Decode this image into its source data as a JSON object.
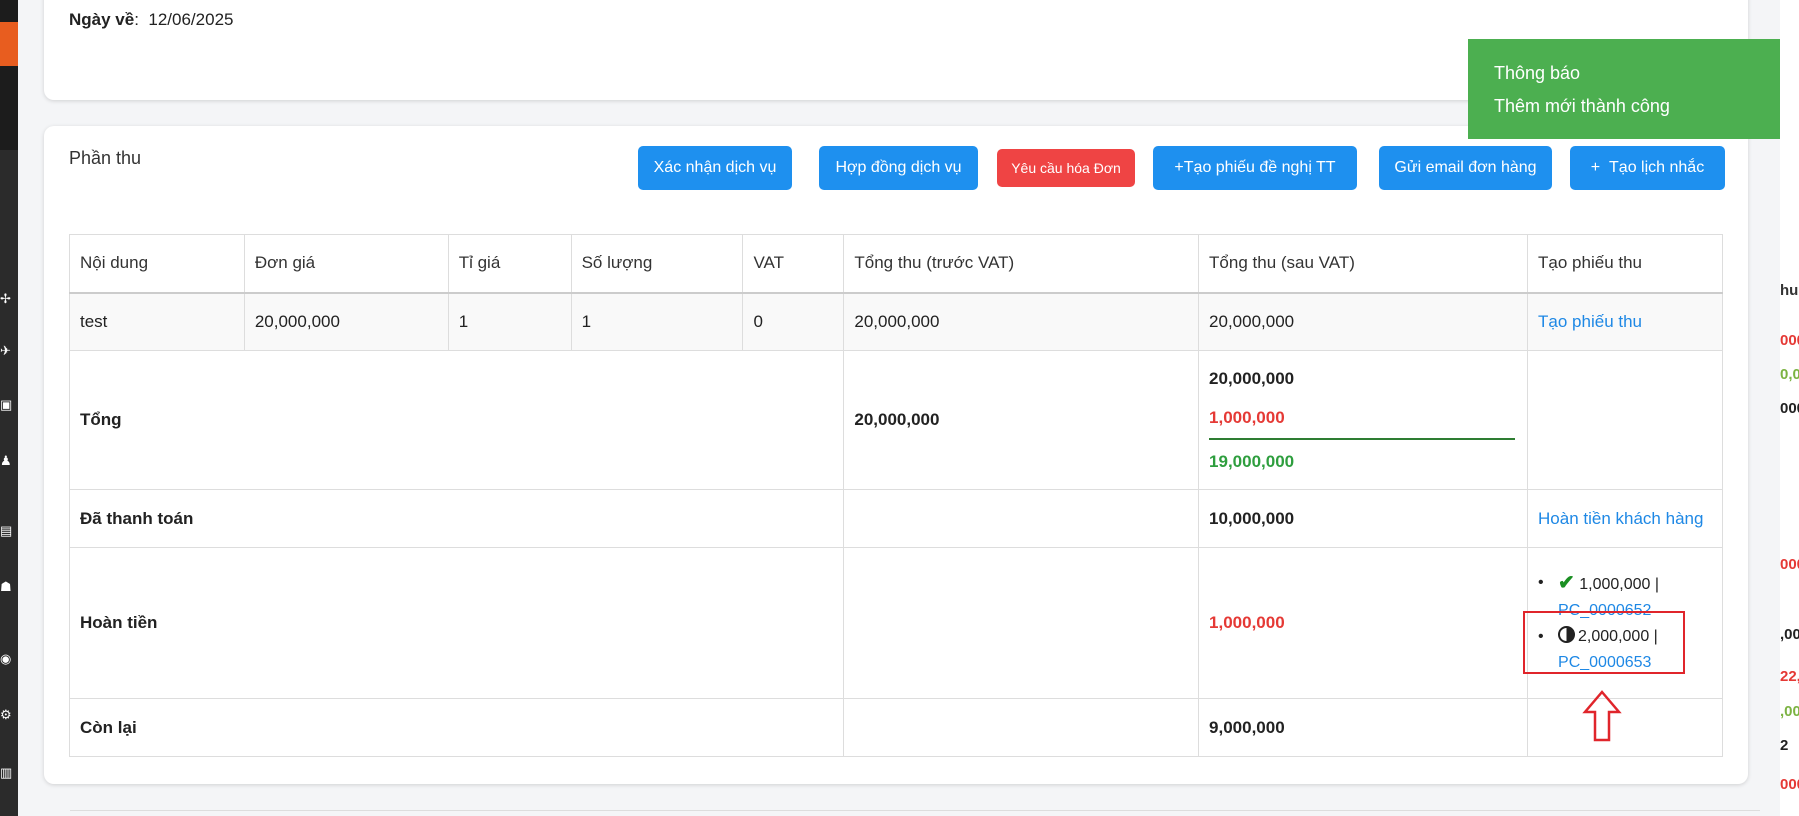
{
  "top_card": {
    "return_date_label": "Ngày về",
    "return_date_sep": ":",
    "return_date_value": "12/06/2025"
  },
  "section": {
    "title": "Phần thu"
  },
  "buttons": {
    "confirm_service": "Xác nhận dịch vụ",
    "service_contract": "Hợp đồng dịch vụ",
    "invoice_request": "Yêu cầu hóa Đơn",
    "create_tt_request": "Tạo phiếu đề nghị TT",
    "send_order_email": "Gửi email đơn hàng",
    "create_reminder": "Tạo lịch nhắc"
  },
  "table": {
    "headers": [
      "Nội dung",
      "Đơn giá",
      "Tỉ giá",
      "Số lượng",
      "VAT",
      "Tổng thu (trước VAT)",
      "Tổng thu (sau VAT)",
      "Tạo phiếu thu"
    ],
    "row": {
      "content": "test",
      "unit_price": "20,000,000",
      "rate": "1",
      "quantity": "1",
      "vat": "0",
      "total_before_vat": "20,000,000",
      "total_after_vat": "20,000,000",
      "action": "Tạo phiếu thu"
    },
    "total": {
      "label": "Tổng",
      "before_vat": "20,000,000",
      "after_vat_gross": "20,000,000",
      "after_vat_deduct": "1,000,000",
      "after_vat_net": "19,000,000"
    },
    "paid": {
      "label": "Đã thanh toán",
      "value": "10,000,000",
      "action": "Hoàn tiền khách hàng"
    },
    "refund": {
      "label": "Hoàn tiền",
      "value": "1,000,000",
      "items": [
        {
          "status_icon": "check-icon",
          "amount": "1,000,000 |",
          "code": "PC_0000652"
        },
        {
          "status_icon": "half-circle-icon",
          "amount": "2,000,000 |",
          "code": "PC_0000653"
        }
      ]
    },
    "remaining": {
      "label": "Còn lại",
      "value": "9,000,000"
    }
  },
  "toast": {
    "title": "Thông báo",
    "message": "Thêm mới thành công",
    "color": "#4caf50"
  },
  "right_peek": {
    "texts": [
      "hu",
      "000",
      "0,0",
      "000",
      "000",
      ",00",
      "22,",
      ",00",
      "2",
      "000"
    ]
  },
  "colors": {
    "primary": "#1e90ef",
    "danger": "#ef4444",
    "link": "#1e88e5",
    "negative": "#e53935",
    "positive": "#2e9e3e"
  }
}
